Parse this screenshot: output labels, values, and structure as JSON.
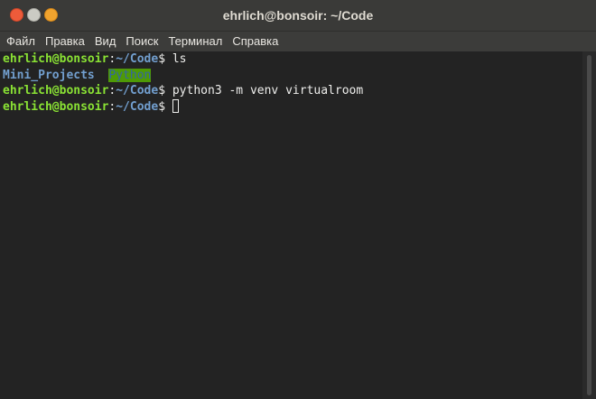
{
  "window": {
    "title": "ehrlich@bonsoir: ~/Code"
  },
  "menu": {
    "items": [
      "Файл",
      "Правка",
      "Вид",
      "Поиск",
      "Терминал",
      "Справка"
    ]
  },
  "prompt": {
    "userhost": "ehrlich@bonsoir",
    "colon": ":",
    "path": "~/Code",
    "dollar": "$"
  },
  "terminal": {
    "cmd1": " ls",
    "ls_output": {
      "dir1": "Mini_Projects",
      "separator": "  ",
      "dir2": "Python"
    },
    "cmd2": " python3 -m venv virtualroom",
    "cmd3": " "
  },
  "colors": {
    "prompt_userhost": "#8ae234",
    "prompt_path": "#729fcf",
    "dir_highlight_bg": "#4e9a06",
    "dir_highlight_fg": "#3465a4",
    "terminal_bg": "#232323",
    "titlebar_bg": "#3a3a38",
    "close_button": "#ed5b3a",
    "minimize_button": "#cbcbc4",
    "maximize_button": "#f0a32e"
  }
}
